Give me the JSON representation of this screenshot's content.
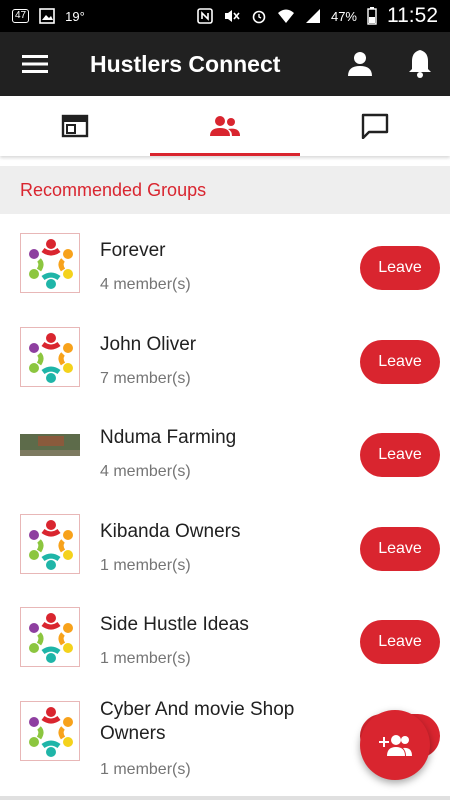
{
  "status_bar": {
    "notif_badge": "47",
    "temperature": "19°",
    "battery": "47%",
    "time": "11:52"
  },
  "app": {
    "title": "Hustlers Connect"
  },
  "tabs": [
    {
      "icon": "feed-icon",
      "active": false
    },
    {
      "icon": "group-icon",
      "active": true
    },
    {
      "icon": "chat-icon",
      "active": false
    }
  ],
  "section": {
    "title": "Recommended Groups"
  },
  "groups": [
    {
      "name": "Forever",
      "members": "4 member(s)",
      "action": "Leave",
      "thumb": "group-logo"
    },
    {
      "name": "John Oliver",
      "members": "7 member(s)",
      "action": "Leave",
      "thumb": "group-logo"
    },
    {
      "name": "Nduma Farming",
      "members": "4 member(s)",
      "action": "Leave",
      "thumb": "farm-photo"
    },
    {
      "name": "Kibanda Owners",
      "members": "1 member(s)",
      "action": "Leave",
      "thumb": "group-logo"
    },
    {
      "name": "Side Hustle Ideas",
      "members": "1 member(s)",
      "action": "Leave",
      "thumb": "group-logo"
    },
    {
      "name": "Cyber And movie Shop Owners",
      "members": "1 member(s)",
      "action": "Leave",
      "thumb": "group-logo"
    }
  ],
  "colors": {
    "accent": "#d9252f",
    "appbar": "#212121",
    "section_bg": "#eeeeee"
  }
}
